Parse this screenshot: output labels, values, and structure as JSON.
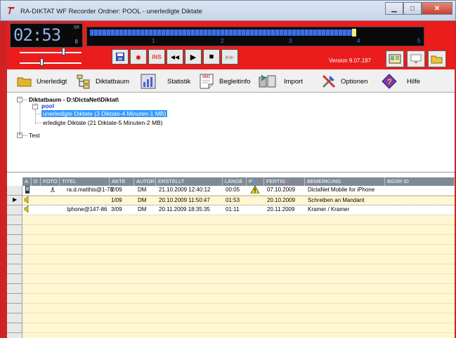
{
  "window": {
    "title": "RA-DIKTAT WF Recorder Ordner: POOL - unerledigte Diktate"
  },
  "recorder": {
    "time": "02:53",
    "small_label": "SR",
    "channel": "8",
    "progress_fraction": 0.79,
    "ticks": [
      "1",
      "2",
      "3",
      "4",
      "5"
    ],
    "version": "Version 9.07.197",
    "controls": {
      "save": "💾",
      "record": "●",
      "ins": "INS",
      "rewind": "◀◀",
      "play": "▶",
      "stop": "■",
      "forward": "▶▶"
    }
  },
  "toolbar": {
    "items": [
      {
        "label": "Unerledigt",
        "icon": "folder-icon"
      },
      {
        "label": "Diktatbaum",
        "icon": "tree-icon"
      },
      {
        "label": "Statistik",
        "icon": "chart-icon"
      },
      {
        "label": "Begleitinfo",
        "icon": "note-icon"
      },
      {
        "label": "Import",
        "icon": "import-icon"
      },
      {
        "label": "Optionen",
        "icon": "tools-icon"
      },
      {
        "label": "Hilfe",
        "icon": "help-book-icon"
      }
    ],
    "note_badge": "0001"
  },
  "tree": {
    "root": "Diktatbaum - D:\\DictaNet\\Diktat\\",
    "pool": "pool",
    "unerledigt": "unerledigte Diktate (3 Diktate-4 Minuten-1 MB)",
    "erledigt": "erledigte Diktate (21 Diktate-5 Minuten-2 MB)",
    "test": "Test"
  },
  "grid": {
    "columns": [
      "A",
      "D",
      "FOTO",
      "TITEL",
      "AKTE",
      "AUTOR",
      "ERSTELLT",
      "LÄNGE",
      "P",
      "FERTIG",
      "BEMERKUNG",
      "BGSR ID"
    ],
    "rows": [
      {
        "titel": "ra.d.matthis@1-78",
        "akte": "2/09",
        "autor": "DM",
        "erstellt": "21.10.2009 12:40:12",
        "laenge": "00:05",
        "warn": true,
        "fertig": "07.10.2009",
        "bemerkung": "DictaNet Mobile for iPhone",
        "icon_a": "mobile-icon",
        "icon_foto": "photo-icon"
      },
      {
        "titel": "",
        "akte": "1/09",
        "autor": "DM",
        "erstellt": "20.10.2009 11:50:47",
        "laenge": "01:53",
        "warn": false,
        "fertig": "20.10.2009",
        "bemerkung": "Schreiben an Mandant",
        "icon_a": "speaker-icon",
        "icon_foto": ""
      },
      {
        "titel": "Iphone@147-86",
        "akte": "3/09",
        "autor": "DM",
        "erstellt": "20.11.2009 18:35:35",
        "laenge": "01:11",
        "warn": false,
        "fertig": "20.11.2009",
        "bemerkung": "Kramer / Kramer",
        "icon_a": "speaker-icon",
        "icon_foto": ""
      }
    ],
    "current_row_marker": "▶"
  }
}
